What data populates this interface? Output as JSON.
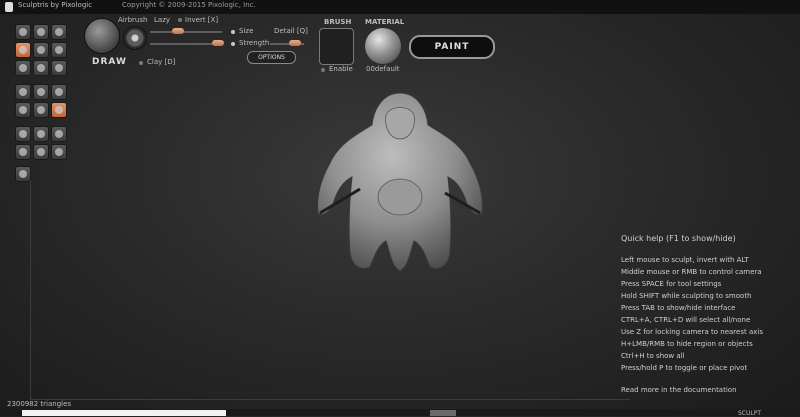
{
  "titlebar": {
    "app_name": "Sculptris by Pixologic",
    "copyright": "Copyright © 2009-2015 Pixologic, Inc."
  },
  "brush_panel": {
    "draw_label": "DRAW",
    "airbrush_label": "Airbrush",
    "lazy_label": "Lazy",
    "invert_label": "Invert [X]",
    "size_label": "Size",
    "strength_label": "Strength",
    "detail_label": "Detail [Q]",
    "options_label": "OPTIONS",
    "clay_label": "Clay [D]",
    "size_value_fraction": 0.3,
    "strength_value_fraction": 0.85,
    "detail_value_fraction": 0.8
  },
  "brush": {
    "header": "BRUSH",
    "enable_label": "Enable"
  },
  "material": {
    "header": "MATERIAL",
    "name": "00default"
  },
  "paint_button": "PAINT",
  "quick_help": {
    "title": "Quick help (F1 to show/hide)",
    "lines": [
      "Left mouse to sculpt, invert with ALT",
      "Middle mouse or RMB to control camera",
      "Press SPACE for tool settings",
      "Hold SHIFT while sculpting to smooth",
      "Press TAB to show/hide interface",
      "CTRL+A, CTRL+D will select all/none",
      "Use Z for locking camera to nearest axis",
      "H+LMB/RMB to hide region or objects",
      "Ctrl+H to show all",
      "Press/hold P to toggle or place pivot"
    ],
    "more": "Read more in the documentation"
  },
  "status": {
    "triangles": "2300982 triangles",
    "corner_text": "SCULPT"
  },
  "colors": {
    "accent_orange": "#cf7444",
    "background": "#2a2a2a",
    "paint_border": "#9a9a9a"
  },
  "tool_icons": [
    "crease-icon",
    "rotate-icon",
    "scale-icon",
    "draw-icon",
    "flatten-icon",
    "grab-icon",
    "inflate-icon",
    "pinch-icon",
    "smooth-icon",
    "mask-icon",
    "sphere-icon",
    "cut-icon",
    "reduce-icon",
    "symmetry-icon",
    "wireframe-icon",
    "orange-tool-icon",
    "texture-icon",
    "grid-icon",
    "light-icon",
    "undo-icon",
    "plane-icon",
    "pan-icon",
    "goz-icon"
  ]
}
